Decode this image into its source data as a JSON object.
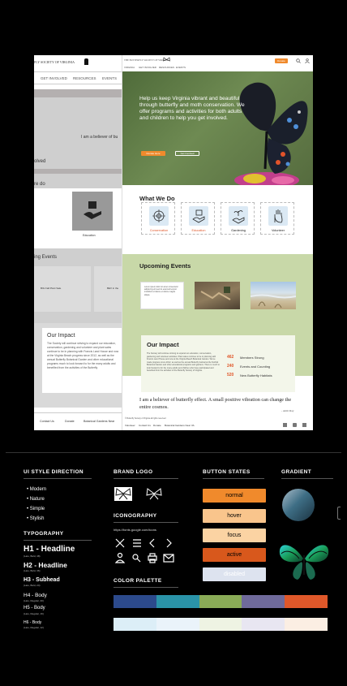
{
  "wireframe": {
    "logo_text": "FLY SOCIETY OF VIRGINIA",
    "nav": [
      "GET INVOLVED",
      "RESOURCES",
      "EVENTS"
    ],
    "belief_text": "I am a believer of bu",
    "section_involved": "olved",
    "section_do": "re do",
    "education_label": "Education",
    "section_events": "ing Events",
    "event_labels": [
      "BIG Fall Plant Sale",
      "BEV in the"
    ],
    "impact_title": "Our Impact",
    "impact_body": "The Society will continue striving to expand our education, conservation, gardening and volunteer and plant sales continue to be in planning with Francis Land House and now at the Virginia Beach progress since 2012, as well as the annual Butterfly Botanical Garden and other educational programs much to look forward to for the many adults and benefited from the activities of the Butterfly",
    "footer_links": [
      "Contact Us",
      "Donate",
      "Botanical Gardens Near"
    ]
  },
  "mock": {
    "logo_text": "THE BUTTERFLY SOCIETY OF VIRGINIA",
    "nav": [
      "VIRGINIA",
      "GET INVOLVED",
      "RESOURCES",
      "EVENTS"
    ],
    "donate": "Donate",
    "hero_text": "Help us keep Virginia vibrant and beautiful through butterfly and moth conservation. We offer programs and activities for both adults and children to help you get involved.",
    "hero_btn1": "Donate Here",
    "hero_btn2": "Get Involved",
    "what_we_do_title": "What We Do",
    "what_we_do": [
      {
        "label": "Conservation",
        "icon": "mandala-icon",
        "color": "#e0572a"
      },
      {
        "label": "Education",
        "icon": "hand-book-icon",
        "color": "#e0572a"
      },
      {
        "label": "Gardening",
        "icon": "hand-sprout-icon",
        "color": "#333333"
      },
      {
        "label": "Volunteer",
        "icon": "raised-hand-icon",
        "color": "#333333"
      }
    ],
    "events_title": "Upcoming Events",
    "event_card_text": "Lorem ipsum dolor sit amet consectetur adipiscing elit sed do eiusmod tempor incididunt ut labore et dolore magna aliqua.",
    "impact_title": "Our Impact",
    "impact_body": "The Society will continue striving to expand our education, conservation, gardening and volunteer activities. Plant sales continue to be in planning with Francis Land House and now at the Virginia Beach Botanical Garden. We've made progress since 2012, as well as the annual Butterfly festival at the Norfolk Botanical Garden and other educational programs and gardens. There is much to look forward to for the many adults and children who have participated and benefited from the activities of the Butterfly Society of Virginia.",
    "stats": [
      {
        "num": "462",
        "label": "Members Strong"
      },
      {
        "num": "240",
        "label": "Events and Counting"
      },
      {
        "num": "520",
        "label": "New Butterfly Habitats"
      }
    ],
    "quote": "I am a believer of butterfly effect.  A small positive vibration can change the entire cosmos.",
    "quote_author": "- Amit Ray",
    "copyright": "© Butterfly Society of Virginia all rights reserved",
    "footer_links": [
      "Volunteer",
      "Contact Us",
      "Donate",
      "Botanical Gardens Near VA"
    ]
  },
  "guide": {
    "ui_style_title": "UI STYLE DIRECTION",
    "ui_style_items": [
      "Modern",
      "Nature",
      "Simple",
      "Stylish"
    ],
    "typography_title": "TYPOGRAPHY",
    "typography": [
      {
        "name": "H1 - Headline",
        "spec": "(Lato, Bold, 48)"
      },
      {
        "name": "H2 - Headline",
        "spec": "(Lato, Bold, 36)"
      },
      {
        "name": "H3 - Subhead",
        "spec": "(Lato, Bold, 24)"
      },
      {
        "name": "H4 - Body",
        "spec": "(Lato, Regular, 20)"
      },
      {
        "name": "H5 - Body",
        "spec": "(Lato, Regular, 16)"
      },
      {
        "name": "H6 - Body",
        "spec": "(Lato, Regular, 12)"
      }
    ],
    "brand_logo_title": "BRAND LOGO",
    "iconography_title": "ICONOGRAPHY",
    "icon_source": "https://fonts.google.com/icons",
    "icons": [
      "close-icon",
      "menu-icon",
      "chevron-left-icon",
      "chevron-right-icon",
      "person-icon",
      "search-icon",
      "print-icon",
      "mail-icon"
    ],
    "palette_title": "COLOR PALETTE",
    "palette_main": [
      "#2c4a8c",
      "#2a93a8",
      "#8aab57",
      "#6f6a9b",
      "#e0582a"
    ],
    "palette_light": [
      "#dceef7",
      "#eaf3fa",
      "#eef3e3",
      "#e8e6f1",
      "#fbeee3"
    ],
    "button_states_title": "BUTTON STATES",
    "button_states": [
      {
        "label": "normal",
        "bg": "#f08a2c",
        "color": "#000000"
      },
      {
        "label": "hover",
        "bg": "#f9c58c",
        "color": "#000000"
      },
      {
        "label": "focus",
        "bg": "#fbd3a3",
        "color": "#000000"
      },
      {
        "label": "active",
        "bg": "#d8581c",
        "color": "#000000"
      },
      {
        "label": "disabled",
        "bg": "#dde3ef",
        "color": "#ffffff"
      }
    ],
    "gradient_title": "GRADIENT"
  }
}
